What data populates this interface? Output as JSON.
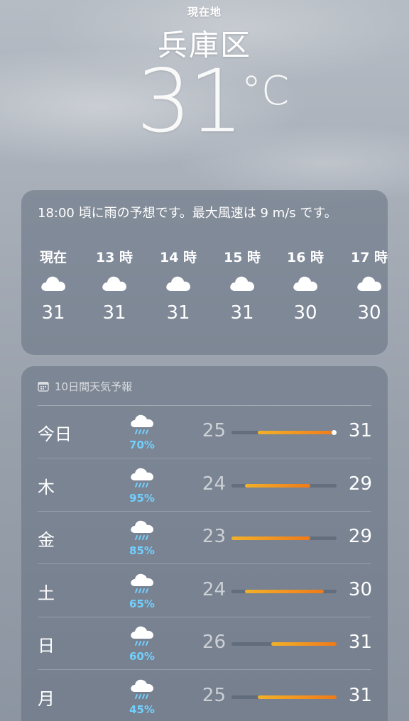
{
  "header": {
    "location_label": "現在地",
    "city": "兵庫区",
    "temperature": "31",
    "unit": "°C"
  },
  "hourly": {
    "summary": "18:00 頃に雨の予想です。最大風速は 9 m/s です。",
    "items": [
      {
        "label": "現在",
        "icon": "cloud-icon",
        "temp": "31"
      },
      {
        "label": "13 時",
        "icon": "cloud-icon",
        "temp": "31"
      },
      {
        "label": "14 時",
        "icon": "cloud-icon",
        "temp": "31"
      },
      {
        "label": "15 時",
        "icon": "cloud-icon",
        "temp": "31"
      },
      {
        "label": "16 時",
        "icon": "cloud-icon",
        "temp": "30"
      },
      {
        "label": "17 時",
        "icon": "cloud-icon",
        "temp": "30"
      }
    ]
  },
  "daily": {
    "header": "10日間天気予報",
    "header_icon": "calendar-icon",
    "range_min": 23,
    "range_max": 31,
    "current_temp": 31,
    "days": [
      {
        "day": "今日",
        "icon": "rain-cloud-icon",
        "precip": "70%",
        "low": "25",
        "high": "31",
        "low_val": 25,
        "high_val": 31,
        "show_current": true
      },
      {
        "day": "木",
        "icon": "rain-cloud-icon",
        "precip": "95%",
        "low": "24",
        "high": "29",
        "low_val": 24,
        "high_val": 29,
        "show_current": false
      },
      {
        "day": "金",
        "icon": "rain-cloud-icon",
        "precip": "85%",
        "low": "23",
        "high": "29",
        "low_val": 23,
        "high_val": 29,
        "show_current": false
      },
      {
        "day": "土",
        "icon": "rain-cloud-icon",
        "precip": "65%",
        "low": "24",
        "high": "30",
        "low_val": 24,
        "high_val": 30,
        "show_current": false
      },
      {
        "day": "日",
        "icon": "rain-cloud-icon",
        "precip": "60%",
        "low": "26",
        "high": "31",
        "low_val": 26,
        "high_val": 31,
        "show_current": false
      },
      {
        "day": "月",
        "icon": "rain-cloud-icon",
        "precip": "45%",
        "low": "25",
        "high": "31",
        "low_val": 25,
        "high_val": 31,
        "show_current": false
      }
    ]
  },
  "colors": {
    "precip": "#72d0ff",
    "bar_start": "#f2b128",
    "bar_end": "#f07a1a"
  }
}
